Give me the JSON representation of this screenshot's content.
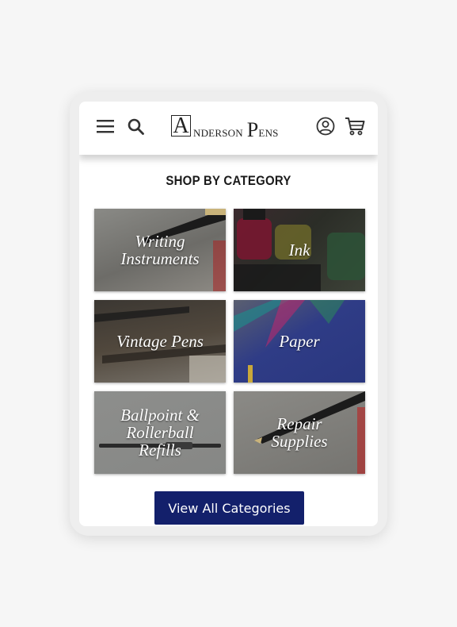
{
  "header": {
    "logo_initial_a": "A",
    "logo_text_a": "nderson",
    "logo_initial_p": "P",
    "logo_text_p": "ens",
    "icons": [
      "menu-icon",
      "search-icon",
      "account-icon",
      "cart-icon"
    ]
  },
  "section": {
    "title": "SHOP BY CATEGORY"
  },
  "categories": [
    {
      "label_line1": "Writing",
      "label_line2": "Instruments",
      "label_line3": ""
    },
    {
      "label_line1": "Ink",
      "label_line2": "",
      "label_line3": ""
    },
    {
      "label_line1": "Vintage Pens",
      "label_line2": "",
      "label_line3": ""
    },
    {
      "label_line1": "Paper",
      "label_line2": "",
      "label_line3": ""
    },
    {
      "label_line1": "Ballpoint &",
      "label_line2": "Rollerball",
      "label_line3": "Refills"
    },
    {
      "label_line1": "Repair",
      "label_line2": "Supplies",
      "label_line3": ""
    }
  ],
  "cta": {
    "label": "View All Categories"
  },
  "colors": {
    "page_background": "#f6f6f6",
    "device_frame": "#eeeeee",
    "button_background": "#13206b",
    "button_text": "#ffffff",
    "title_text": "#1a1a1a"
  }
}
